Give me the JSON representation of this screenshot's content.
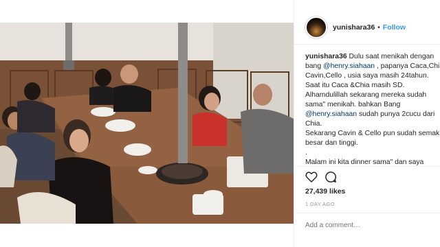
{
  "post": {
    "username": "yunishara36",
    "follow_label": "Follow",
    "separator": "•",
    "caption_lines": [
      {
        "user": "yunishara36",
        "text": " Dulu saat menikah dengan"
      },
      {
        "pre": "bang ",
        "mention": "@henry.siahaan",
        "text": " , papanya Caca,Chia"
      },
      {
        "text": "Cavin,Cello , usia saya masih 24tahun."
      },
      {
        "text": "Saat itu Caca &Chia masih SD."
      },
      {
        "text": "Alhamdulillah sekarang mereka sudah"
      },
      {
        "text": "sama\" menikah. bahkan Bang"
      },
      {
        "mention": "@henry.siahaan",
        "text": " sudah punya 2cucu dari"
      },
      {
        "text": "Chia."
      },
      {
        "text": "Sekarang Cavin & Cello pun sudah semakin"
      },
      {
        "text": "besar dan tinggi."
      },
      {
        "text": "."
      },
      {
        "text": "Malam ini kita dinner sama\" dan saya"
      }
    ],
    "likes": "27,439 likes",
    "time_ago": "1 DAY AGO",
    "comment_placeholder": "Add a comment…"
  },
  "icons": {
    "like": "heart-icon",
    "comment": "comment-icon"
  },
  "colors": {
    "link": "#3897f0",
    "mention": "#003569",
    "text": "#262626",
    "muted": "#999999"
  }
}
